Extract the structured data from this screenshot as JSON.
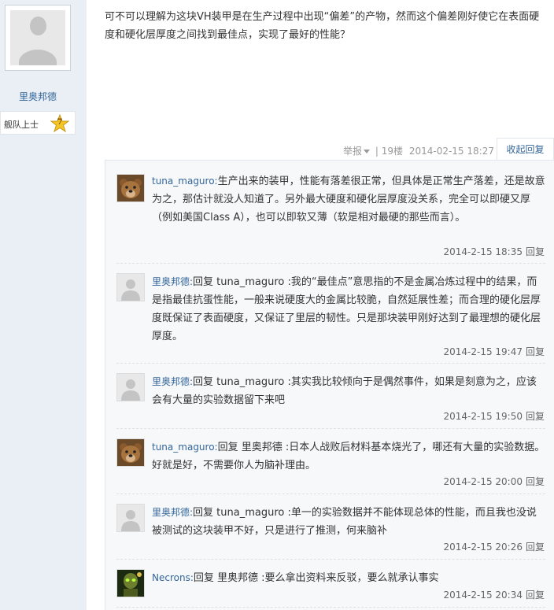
{
  "user": {
    "name": "里奥邦德",
    "rank": "舰队上士",
    "rank_level": "7"
  },
  "post": {
    "text": "可不可以理解为这块VH装甲是在生产过程中出现“偏差”的产物，然而这个偏差刚好使它在表面硬度和硬化层厚度之间找到最佳点，实现了最好的性能？",
    "report": "举报",
    "sep": "|",
    "floor": "19楼",
    "date": "2014-02-15 18:27",
    "collapse": "收起回复"
  },
  "comments": [
    {
      "author": "tuna_maguro:",
      "text": "生产出来的装甲，性能有落差很正常，但具体是正常生产落差，还是故意为之，那估计就没人知道了。另外最大硬度和硬化层厚度没关系，完全可以即硬又厚（例如美国Class A），也可以即软又薄（软是相对最硬的那些而言）。",
      "time": "2014-2-15 18:35",
      "reply": "回复",
      "avatar": "bear-avatar"
    },
    {
      "author": "里奥邦德:",
      "text": "回复 tuna_maguro :我的“最佳点”意思指的不是金属冶炼过程中的结果，而是指最佳抗蛋性能，一般来说硬度大的金属比较脆，自然延展性差；而合理的硬化层厚度既保证了表面硬度，又保证了里层的韧性。只是那块装甲刚好达到了最理想的硬化层厚度。",
      "time": "2014-2-15 19:47",
      "reply": "回复",
      "avatar": "default-avatar"
    },
    {
      "author": "里奥邦德:",
      "text": "回复 tuna_maguro :其实我比较倾向于是偶然事件，如果是刻意为之，应该会有大量的实验数据留下来吧",
      "time": "2014-2-15 19:50",
      "reply": "回复",
      "avatar": "default-avatar"
    },
    {
      "author": "tuna_maguro:",
      "text": "回复 里奥邦德 :日本人战败后材料基本烧光了，哪还有大量的实验数据。好就是好，不需要你人为脑补理由。",
      "time": "2014-2-15 20:00",
      "reply": "回复",
      "avatar": "bear-avatar"
    },
    {
      "author": "里奥邦德:",
      "text": "回复 tuna_maguro :单一的实验数据并不能体现总体的性能，而且我也没说被测试的这块装甲不好，只是进行了推测，何来脑补",
      "time": "2014-2-15 20:26",
      "reply": "回复",
      "avatar": "default-avatar"
    },
    {
      "author": "Necrons:",
      "text": "回复 里奥邦德 :要么拿出资料来反驳，要么就承认事实",
      "time": "2014-2-15 20:34",
      "reply": "回复",
      "avatar": "necron-avatar"
    }
  ],
  "colors": {
    "link": "#336699",
    "meta": "#999999",
    "sidebar": "#e9eff5"
  }
}
